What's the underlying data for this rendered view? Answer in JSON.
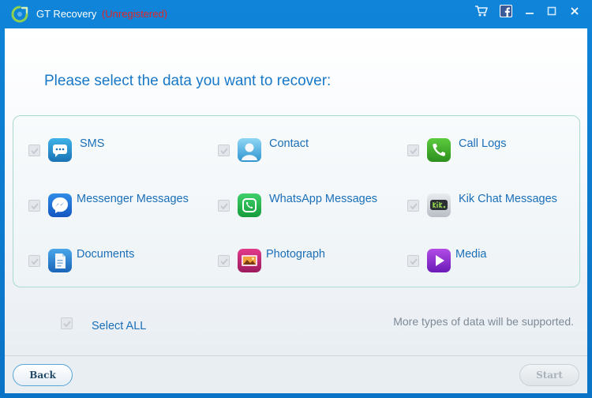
{
  "window": {
    "app_name": "GT Recovery",
    "status": "(Unregistered)",
    "controls": {
      "cart_icon": "shopping-cart-icon",
      "facebook_icon": "facebook-icon",
      "minimize_icon": "minimize-icon",
      "maximize_icon": "maximize-icon",
      "close_icon": "close-icon"
    }
  },
  "main": {
    "heading": "Please select the data you want to recover:",
    "data_types": [
      {
        "label": "SMS",
        "icon": "sms-icon",
        "checked": true,
        "enabled": false
      },
      {
        "label": "Contact",
        "icon": "contact-icon",
        "checked": true,
        "enabled": false
      },
      {
        "label": "Call Logs",
        "icon": "phone-icon",
        "checked": true,
        "enabled": false
      },
      {
        "label": "Messenger Messages",
        "icon": "messenger-icon",
        "checked": true,
        "enabled": false
      },
      {
        "label": "WhatsApp Messages",
        "icon": "whatsapp-icon",
        "checked": true,
        "enabled": false
      },
      {
        "label": "Kik Chat Messages",
        "icon": "kik-icon",
        "checked": true,
        "enabled": false
      },
      {
        "label": "Documents",
        "icon": "document-icon",
        "checked": true,
        "enabled": false
      },
      {
        "label": "Photograph",
        "icon": "photograph-icon",
        "checked": true,
        "enabled": false
      },
      {
        "label": "Media",
        "icon": "media-play-icon",
        "checked": true,
        "enabled": false
      }
    ],
    "select_all_label": "Select ALL",
    "note": "More types of data will be supported."
  },
  "footer": {
    "back_label": "Back",
    "start_label": "Start"
  },
  "colors": {
    "titlebar": "#0a73c6",
    "accent_text": "#1878c8",
    "unregistered": "#e0262a"
  }
}
